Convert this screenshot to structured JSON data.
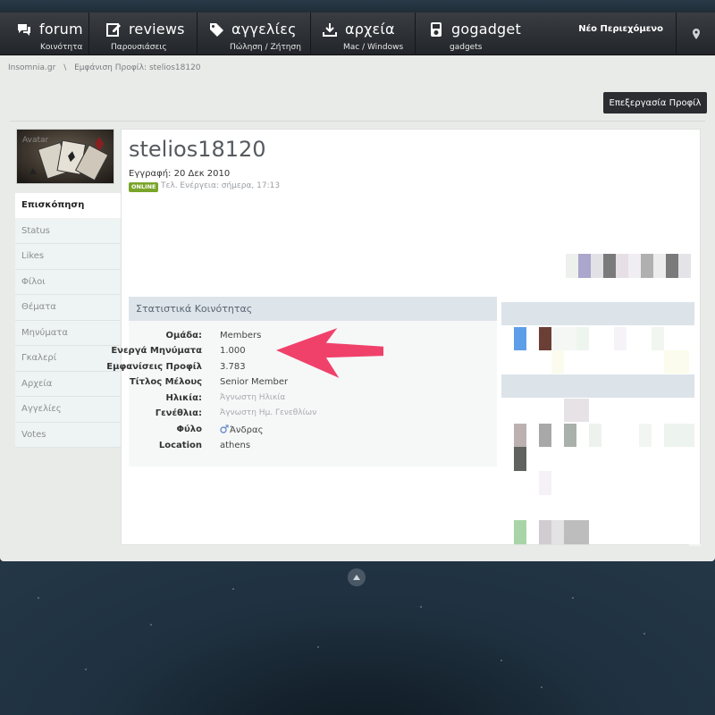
{
  "nav": {
    "items": [
      {
        "label": "forum",
        "sub": "Κοινότητα",
        "icon": "chat-icon"
      },
      {
        "label": "reviews",
        "sub": "Παρουσιάσεις",
        "icon": "edit-icon"
      },
      {
        "label": "αγγελίες",
        "sub": "Πώληση / Ζήτηση",
        "icon": "tag-icon"
      },
      {
        "label": "αρχεία",
        "sub": "Mac / Windows",
        "icon": "download-icon"
      },
      {
        "label": "gogadget",
        "sub": "gadgets",
        "icon": "ipod-icon"
      }
    ],
    "new_content": "Νέο Περιεχόμενο",
    "pin_icon": "map-pin-icon"
  },
  "breadcrumb": {
    "site": "Insomnia.gr",
    "separator": "\\",
    "current": "Εμφάνιση Προφίλ: stelios18120"
  },
  "edit_profile_button": "Επεξεργασία Προφίλ",
  "sidebar": {
    "avatar_alt_text": "Avatar",
    "items": [
      {
        "label": "Επισκόπηση",
        "active": true
      },
      {
        "label": "Status"
      },
      {
        "label": "Likes"
      },
      {
        "label": "Φίλοι"
      },
      {
        "label": "Θέματα"
      },
      {
        "label": "Μηνύματα"
      },
      {
        "label": "Γκαλερί"
      },
      {
        "label": "Αρχεία"
      },
      {
        "label": "Αγγελίες"
      },
      {
        "label": "Votes"
      }
    ]
  },
  "profile": {
    "username": "stelios18120",
    "joined": "Εγγραφή: 20 Δεκ 2010",
    "online_badge": "ONLINE",
    "last_active": "Τελ. Ενέργεια: σήμερα, 17:13"
  },
  "stats": {
    "header": "Στατιστικά Κοινότητας",
    "rows": [
      {
        "label": "Ομάδα:",
        "value": "Members"
      },
      {
        "label": "Ενεργά Μηνύματα",
        "value": "1.000"
      },
      {
        "label": "Εμφανίσεις Προφίλ",
        "value": "3.783"
      },
      {
        "label": "Τίτλος Μέλους",
        "value": "Senior Member"
      },
      {
        "label": "Ηλικία:",
        "value": "Άγνωστη Ηλικία"
      },
      {
        "label": "Γενέθλια:",
        "value": "Άγνωστη Ημ. Γενεθλίων"
      },
      {
        "label": "Φύλο",
        "value": "Άνδρας"
      },
      {
        "label": "Location",
        "value": "athens"
      }
    ]
  },
  "colors": {
    "annotation_arrow": "#f0416a",
    "online": "#7aa52a",
    "nav_bg": "#2b2e32"
  }
}
